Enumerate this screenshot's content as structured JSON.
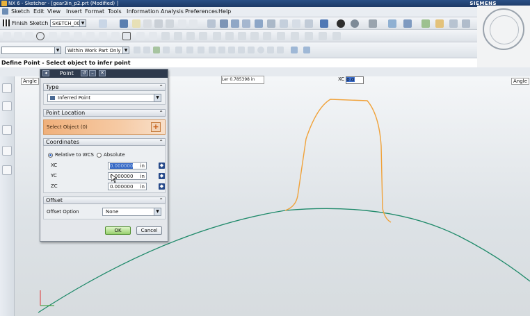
{
  "window": {
    "title": "NX 6 - Sketcher - [gear3in_p2.prt (Modified) ]",
    "brand": "SIEMENS"
  },
  "menu": [
    "Sketch",
    "Edit",
    "View",
    "Insert",
    "Format",
    "Tools",
    "Information",
    "Analysis",
    "Preferences",
    "Help"
  ],
  "toolbar": {
    "finish_sketch_label": "Finish Sketch",
    "sketch_name": "SKETCH_000",
    "scope_filter": "Within Work Part Only"
  },
  "prompt": "Define Point - Select object to infer point",
  "canvas": {
    "angle_left": "Angle",
    "angle_right": "Angle",
    "length_label": "Ler",
    "length_value": "0.785398 in",
    "xc_label": "XC",
    "xc_value": "0.0"
  },
  "dialog": {
    "title": "Point",
    "type": {
      "header": "Type",
      "value": "Inferred Point"
    },
    "location": {
      "header": "Point Location",
      "select_prompt": "Select Object (0)"
    },
    "coordinates": {
      "header": "Coordinates",
      "relative_option": "Relative to WCS",
      "absolute_option": "Absolute",
      "xc_label": "XC",
      "yc_label": "YC",
      "zc_label": "ZC",
      "xc_value": "0.000000",
      "yc_value": "0.000000",
      "zc_value": "0.000000",
      "unit": "in"
    },
    "offset": {
      "header": "Offset",
      "option_label": "Offset Option",
      "option_value": "None"
    },
    "ok_label": "OK",
    "cancel_label": "Cancel"
  },
  "colors": {
    "tooth_profile": "#f0a23a",
    "base_circle": "#1f8a6a",
    "accent": "#3266c4"
  }
}
